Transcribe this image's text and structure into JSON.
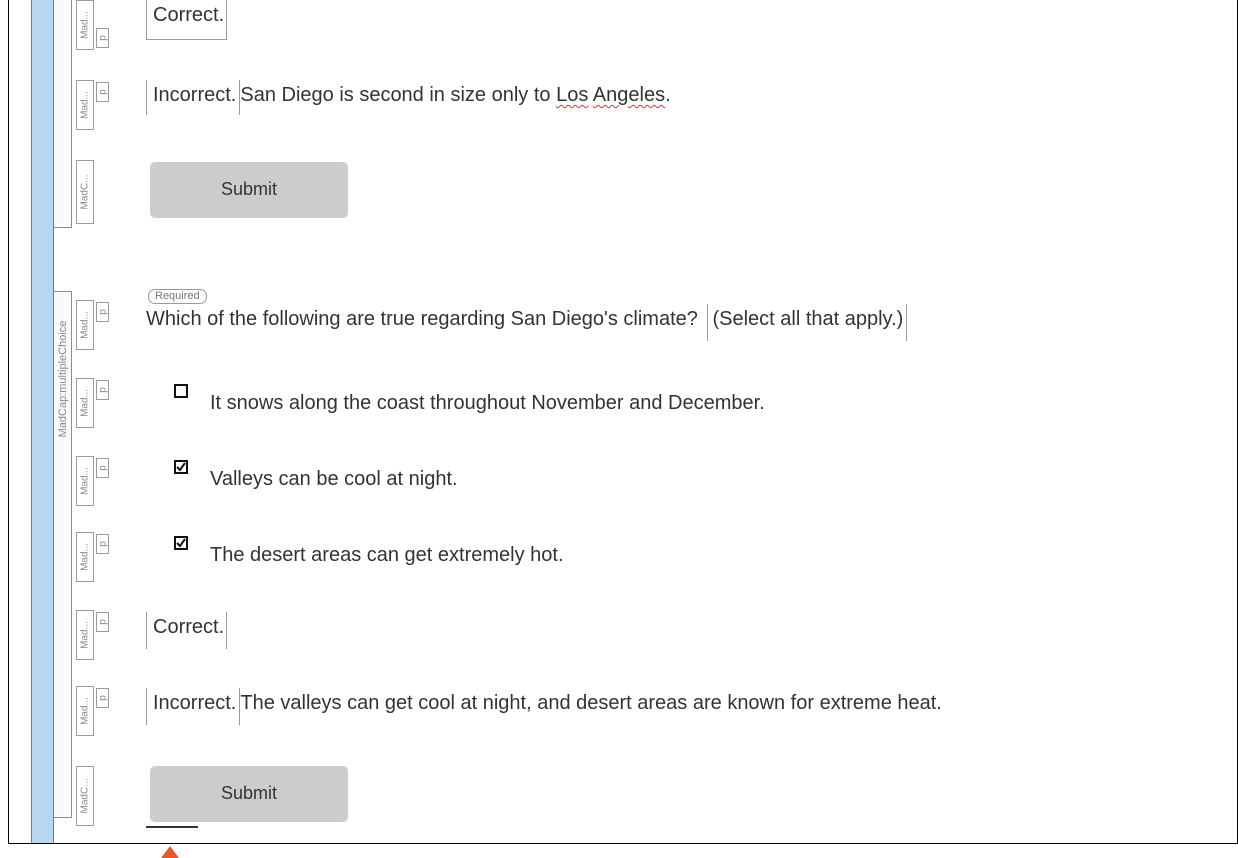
{
  "structure": {
    "multiple_choice_label": "MadCap:multipleChoice",
    "short_tag": "Mad...",
    "short_tag_c": "MadC...",
    "p_tag": "p"
  },
  "quiz1": {
    "correct_feedback": "Correct.",
    "incorrect_label": "Incorrect.",
    "incorrect_prefix": "San Diego is second in size only to ",
    "incorrect_link_1": "Los",
    "incorrect_link_2": "Angeles",
    "incorrect_suffix": ".",
    "submit_label": "Submit"
  },
  "quiz2": {
    "required_badge": "Required",
    "question": "Which of the following are true regarding San Diego's climate?",
    "instruction": "(Select all that apply.)",
    "options": [
      {
        "label": "It snows along the coast throughout November and December.",
        "checked": false
      },
      {
        "label": "Valleys can be cool at night.",
        "checked": true
      },
      {
        "label": "The desert areas can get extremely hot.",
        "checked": true
      }
    ],
    "correct_feedback": "Correct.",
    "incorrect_label": "Incorrect.",
    "incorrect_text": "The valleys can get cool at night, and desert areas are known for extreme heat.",
    "submit_label": "Submit"
  },
  "colors": {
    "structure_bar": "#b7d7f0",
    "button_bg": "#cccccc",
    "warning": "#e8582a"
  }
}
